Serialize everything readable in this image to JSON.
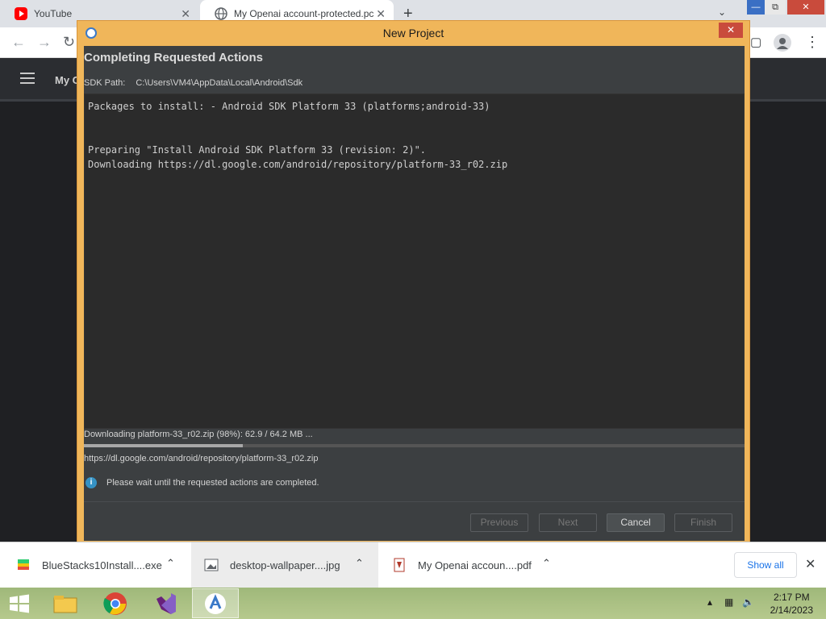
{
  "browser": {
    "tabs": [
      {
        "label": "YouTube",
        "icon": "youtube-icon"
      },
      {
        "label": "My Openai account-protected.pc",
        "icon": "globe-icon"
      }
    ],
    "new_tab": "+",
    "tab_close": "✕"
  },
  "page": {
    "title": "My C"
  },
  "dialog": {
    "title": "New Project",
    "heading": "Completing Requested Actions",
    "sdk_label": "SDK Path:",
    "sdk_path": "C:\\Users\\VM4\\AppData\\Local\\Android\\Sdk",
    "log": "Packages to install: - Android SDK Platform 33 (platforms;android-33)\n\n\nPreparing \"Install Android SDK Platform 33 (revision: 2)\".\nDownloading https://dl.google.com/android/repository/platform-33_r02.zip",
    "status": "Downloading platform-33_r02.zip (98%): 62.9 / 64.2 MB ...",
    "progress_fraction": 0.24,
    "url": "https://dl.google.com/android/repository/platform-33_r02.zip",
    "info": "Please wait until the requested actions are completed.",
    "info_icon": "i",
    "buttons": {
      "previous": "Previous",
      "next": "Next",
      "cancel": "Cancel",
      "finish": "Finish"
    }
  },
  "downloads": {
    "items": [
      {
        "name": "BlueStacks10Install....exe"
      },
      {
        "name": "desktop-wallpaper....jpg"
      },
      {
        "name": "My Openai accoun....pdf"
      }
    ],
    "show_all": "Show all"
  },
  "taskbar": {
    "time": "2:17 PM",
    "date": "2/14/2023"
  }
}
